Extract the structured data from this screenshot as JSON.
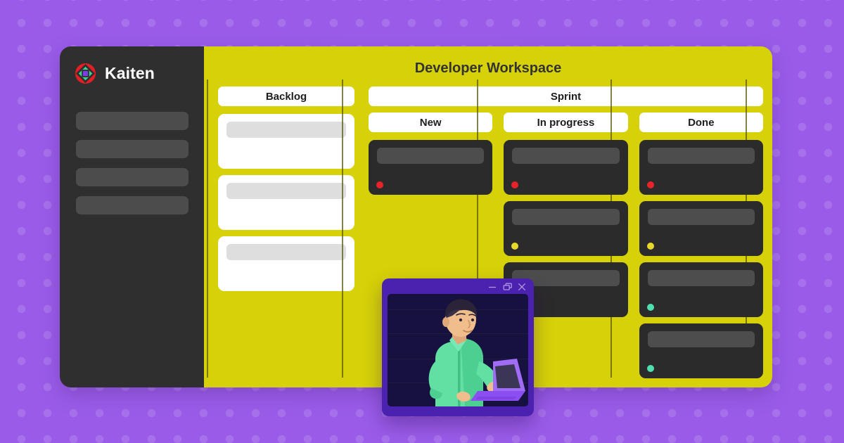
{
  "meta": {
    "background_color": "#9a5ce8",
    "board_color": "#d6d108",
    "sidebar_color": "#2f2f2f",
    "card_dark_color": "#2b2b2b",
    "card_placeholder_color": "#4d4d4d",
    "window_accent_color": "#4b21b0"
  },
  "sidebar": {
    "brand_name": "Kaiten",
    "logo_icon": "kaiten-logo-icon",
    "nav_items": [
      {
        "label": "",
        "icon": "nav-placeholder-item"
      },
      {
        "label": "",
        "icon": "nav-placeholder-item"
      },
      {
        "label": "",
        "icon": "nav-placeholder-item"
      },
      {
        "label": "",
        "icon": "nav-placeholder-item"
      }
    ]
  },
  "board": {
    "title": "Developer Workspace",
    "backlog": {
      "header": "Backlog",
      "cards": [
        {
          "dot_color": null
        },
        {
          "dot_color": null
        },
        {
          "dot_color": null
        }
      ]
    },
    "sprint": {
      "header": "Sprint",
      "lanes": [
        {
          "header": "New",
          "cards": [
            {
              "dot_color": "#e8232a"
            }
          ]
        },
        {
          "header": "In progress",
          "cards": [
            {
              "dot_color": "#e8232a"
            },
            {
              "dot_color": "#e8d82a"
            },
            {
              "dot_color": null
            }
          ]
        },
        {
          "header": "Done",
          "cards": [
            {
              "dot_color": "#e8232a"
            },
            {
              "dot_color": "#e8d82a"
            },
            {
              "dot_color": "#4fe0ae"
            },
            {
              "dot_color": "#4fe0ae"
            }
          ]
        }
      ]
    }
  },
  "float_window": {
    "controls": [
      {
        "name": "minimize",
        "glyph": "minimize-icon"
      },
      {
        "name": "restore",
        "glyph": "restore-window-icon"
      },
      {
        "name": "close",
        "glyph": "close-icon"
      }
    ],
    "illustration": {
      "name": "developer-with-laptop-illustration",
      "shirt_color": "#62e0a4",
      "laptop_color": "#8b4ef0",
      "background_color": "#16113f"
    }
  }
}
